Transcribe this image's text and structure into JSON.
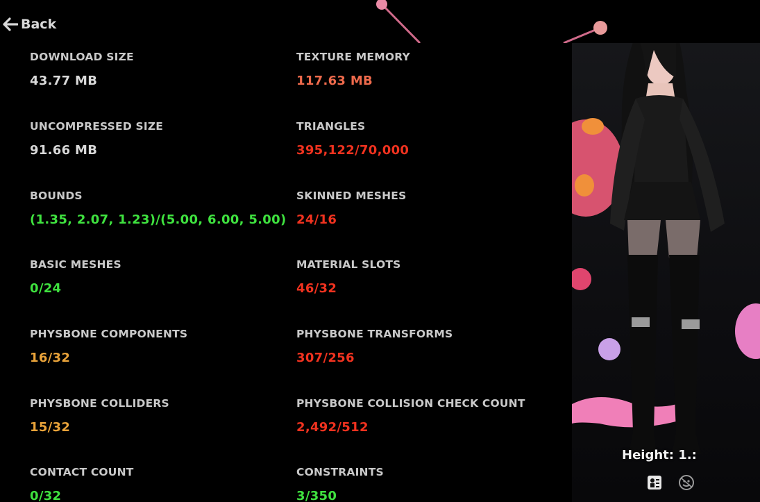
{
  "nav": {
    "back_label": "Back"
  },
  "colors": {
    "label": "#c9c9c9",
    "neutral": "#d9d9d9",
    "good": "#3fe23f",
    "medium": "#e9a33a",
    "poor": "#ee6a4c",
    "very_poor": "#f0321f"
  },
  "stats": {
    "download_size": {
      "label": "DOWNLOAD SIZE",
      "value": "43.77 MB",
      "rating": "neutral"
    },
    "uncompressed_size": {
      "label": "UNCOMPRESSED SIZE",
      "value": "91.66 MB",
      "rating": "neutral"
    },
    "bounds": {
      "label": "BOUNDS",
      "value": "(1.35, 2.07, 1.23)/(5.00, 6.00, 5.00)",
      "rating": "good"
    },
    "basic_meshes": {
      "label": "BASIC MESHES",
      "value": "0/24",
      "rating": "good"
    },
    "physbone_components": {
      "label": "PHYSBONE COMPONENTS",
      "value": "16/32",
      "rating": "medium"
    },
    "physbone_colliders": {
      "label": "PHYSBONE COLLIDERS",
      "value": "15/32",
      "rating": "medium"
    },
    "contact_count": {
      "label": "CONTACT COUNT",
      "value": "0/32",
      "rating": "good"
    },
    "texture_memory": {
      "label": "TEXTURE MEMORY",
      "value": "117.63 MB",
      "rating": "poor"
    },
    "triangles": {
      "label": "TRIANGLES",
      "value": "395,122/70,000",
      "rating": "very_poor"
    },
    "skinned_meshes": {
      "label": "SKINNED MESHES",
      "value": "24/16",
      "rating": "very_poor"
    },
    "material_slots": {
      "label": "MATERIAL SLOTS",
      "value": "46/32",
      "rating": "very_poor"
    },
    "physbone_transforms": {
      "label": "PHYSBONE TRANSFORMS",
      "value": "307/256",
      "rating": "very_poor"
    },
    "physbone_collision_check_count": {
      "label": "PHYSBONE COLLISION CHECK COUNT",
      "value": "2,492/512",
      "rating": "very_poor"
    },
    "constraints": {
      "label": "CONSTRAINTS",
      "value": "3/350",
      "rating": "good"
    }
  },
  "preview": {
    "height_label": "Height: 1.:",
    "toolbar_icons": [
      "info-card-icon",
      "avatar-face-icon"
    ]
  }
}
